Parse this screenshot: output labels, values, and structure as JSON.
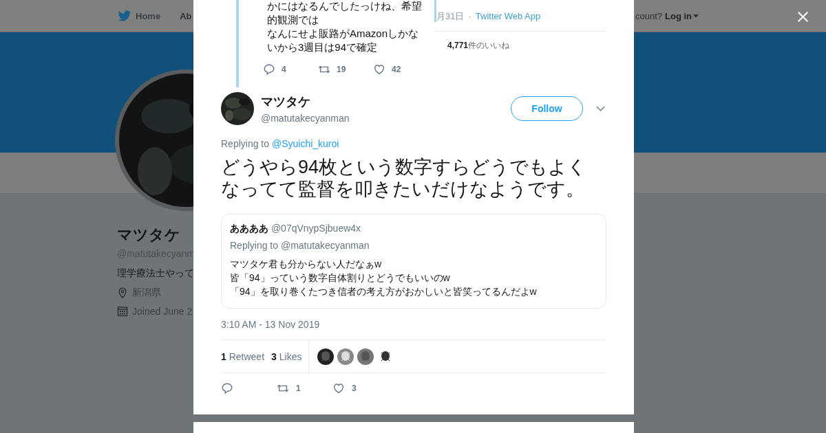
{
  "background_page": {
    "nav": {
      "home": "Home",
      "about": "Ab",
      "login_prompt": "count?",
      "login": "Log in"
    },
    "profile": {
      "name": "マツタケ",
      "handle": "@matutakecyanm",
      "bio": "理学療法士やって",
      "location": "新潟県",
      "joined": "Joined June 2"
    }
  },
  "modal": {
    "embedded_screenshot": {
      "lines": [
        "かにはなるんでしたっけね、希望",
        "的観測では",
        "なんにせよ販路がAmazonしかな",
        "いから3週目は94で確定"
      ],
      "actions": [
        {
          "kind": "reply",
          "count": "4"
        },
        {
          "kind": "retweet",
          "count": "19"
        },
        {
          "kind": "like",
          "count": "42"
        }
      ],
      "date": "月31日",
      "separator": "·",
      "source": "Twitter Web App",
      "likes_count": "4,771",
      "likes_label": "件のいいね"
    },
    "tweet": {
      "name": "マツタケ",
      "handle": "@matutakecyanman",
      "follow": "Follow",
      "replying_label": "Replying to",
      "replying_to": "@Syuichi_kuroi",
      "text": "どうやら94枚という数字すらどうでもよくなってて監督を叩きたいだけなようです。",
      "quote": {
        "name": "ああああ",
        "handle": "@07qVnypSjbuew4x",
        "replying": "Replying to @matutakecyanman",
        "lines": [
          "マツタケ君も分からない人だなぁw",
          "皆「94」っていう数字自体割りとどうでもいいのw",
          "「94」を取り巻くたつき信者の考え方がおかしいと皆笑ってるんだよw"
        ]
      },
      "timestamp": "3:10 AM - 13 Nov 2019",
      "stats": [
        {
          "count": "1",
          "label": "Retweet"
        },
        {
          "count": "3",
          "label": "Likes"
        }
      ],
      "actions": [
        {
          "kind": "reply"
        },
        {
          "kind": "retweet",
          "count": "1"
        },
        {
          "kind": "like",
          "count": "3"
        }
      ]
    }
  }
}
